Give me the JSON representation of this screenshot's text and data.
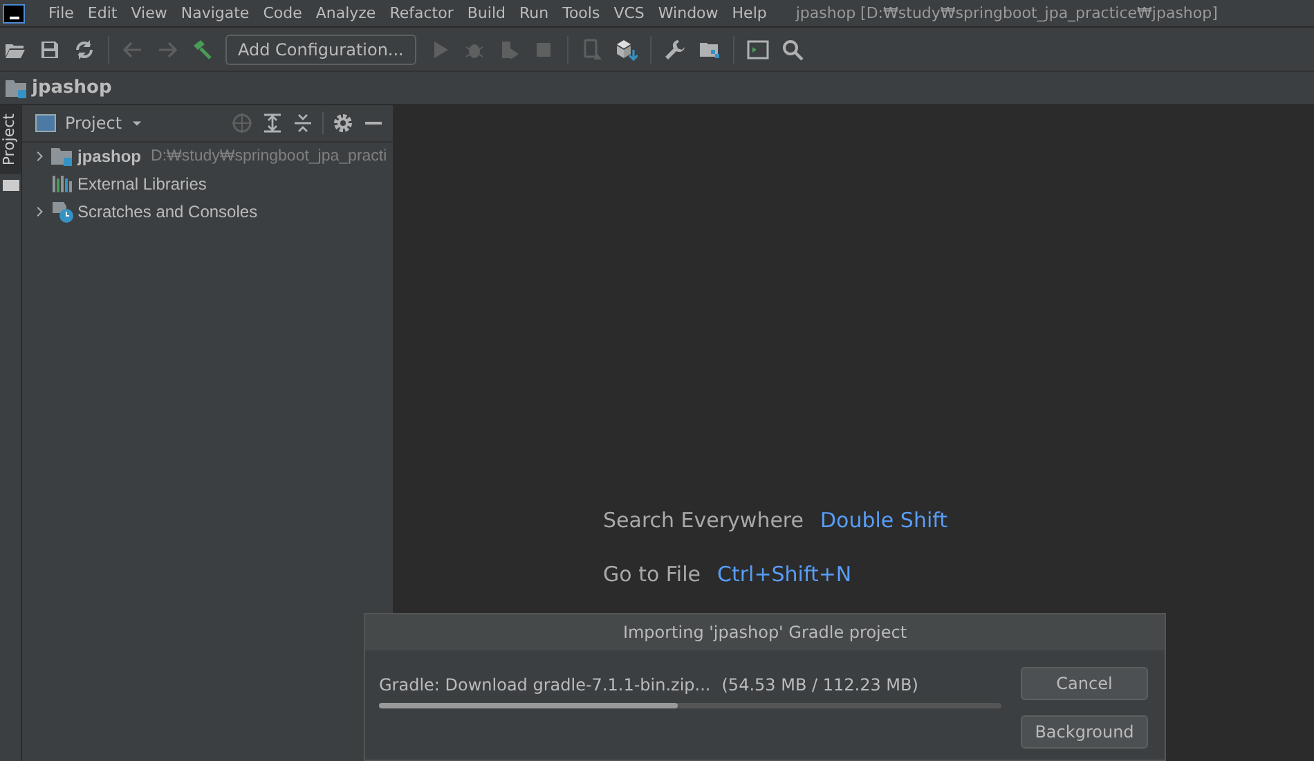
{
  "menu": [
    "File",
    "Edit",
    "View",
    "Navigate",
    "Code",
    "Analyze",
    "Refactor",
    "Build",
    "Run",
    "Tools",
    "VCS",
    "Window",
    "Help"
  ],
  "window": {
    "title": "jpashop [D:₩study₩springboot_jpa_practice₩jpashop]"
  },
  "toolbar": {
    "run_configuration": "Add Configuration..."
  },
  "breadcrumb": "jpashop",
  "side_tab": "Project",
  "project_panel": {
    "title": "Project",
    "tree": [
      {
        "kind": "module",
        "label": "jpashop",
        "path": "D:₩study₩springboot_jpa_practi",
        "expanded": false
      },
      {
        "kind": "libraries",
        "label": "External Libraries"
      },
      {
        "kind": "scratches",
        "label": "Scratches and Consoles",
        "expanded": false
      }
    ]
  },
  "hints": [
    {
      "action": "Search Everywhere",
      "shortcut": "Double Shift"
    },
    {
      "action": "Go to File",
      "shortcut": "Ctrl+Shift+N"
    }
  ],
  "dialog": {
    "title": "Importing 'jpashop' Gradle project",
    "status": "Gradle: Download gradle-7.1.1-bin.zip...",
    "size": "(54.53 MB / 112.23 MB)",
    "level": 0.48,
    "buttons": [
      "Cancel",
      "Background"
    ]
  }
}
